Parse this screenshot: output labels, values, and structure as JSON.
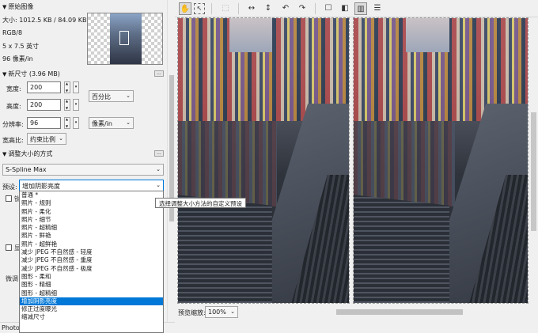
{
  "original": {
    "header": "原始图像",
    "size": "大小: 1012.5 KB / 84.09 KB",
    "mode": "RGB/8",
    "dims": "5 x 7.5 英寸",
    "res": "96 像素/in"
  },
  "newsize": {
    "header": "新尺寸 (3.96 MB)",
    "width_label": "宽度:",
    "width_value": "200",
    "height_label": "高度:",
    "height_value": "200",
    "unit": "百分比",
    "res_label": "分辨率:",
    "res_value": "96",
    "res_unit": "像素/in",
    "ratio_label": "宽高比:",
    "ratio_value": "约束比例"
  },
  "method": {
    "header": "调整大小的方式",
    "algorithm": "S-Spline Max",
    "preset_label": "预设:",
    "preset_value": "增加阴影亮度",
    "tooltip": "选择调整大小方法的自定义预设",
    "options": [
      "普通 *",
      "照片 - 规则",
      "照片 - 柔化",
      "照片 - 细节",
      "照片 - 超精细",
      "照片 - 鲜艳",
      "照片 - 超鲜艳",
      "减少 JPEG 不自然感 - 轻度",
      "减少 JPEG 不自然感 - 重度",
      "减少 JPEG 不自然感 - 极度",
      "图形 - 柔和",
      "图形 - 精细",
      "图形 - 超精细",
      "增加阴影亮度",
      "修正过度曝光",
      "缩减尺寸"
    ],
    "selected_index": 13
  },
  "hidden_labels": {
    "row1": "锐",
    "row2": "显",
    "row3": "微调"
  },
  "status": "Photo",
  "preview": {
    "zoom_label": "预览缩放:",
    "zoom_value": "100%"
  },
  "toolbar": {
    "icons": [
      "hand-icon",
      "select-icon",
      "crop-icon",
      "fit-width-icon",
      "fit-height-icon",
      "rotate-left-icon",
      "rotate-right-icon",
      "single-view-icon",
      "split-view-icon",
      "side-by-side-icon",
      "stacked-view-icon"
    ]
  },
  "dots": "..."
}
